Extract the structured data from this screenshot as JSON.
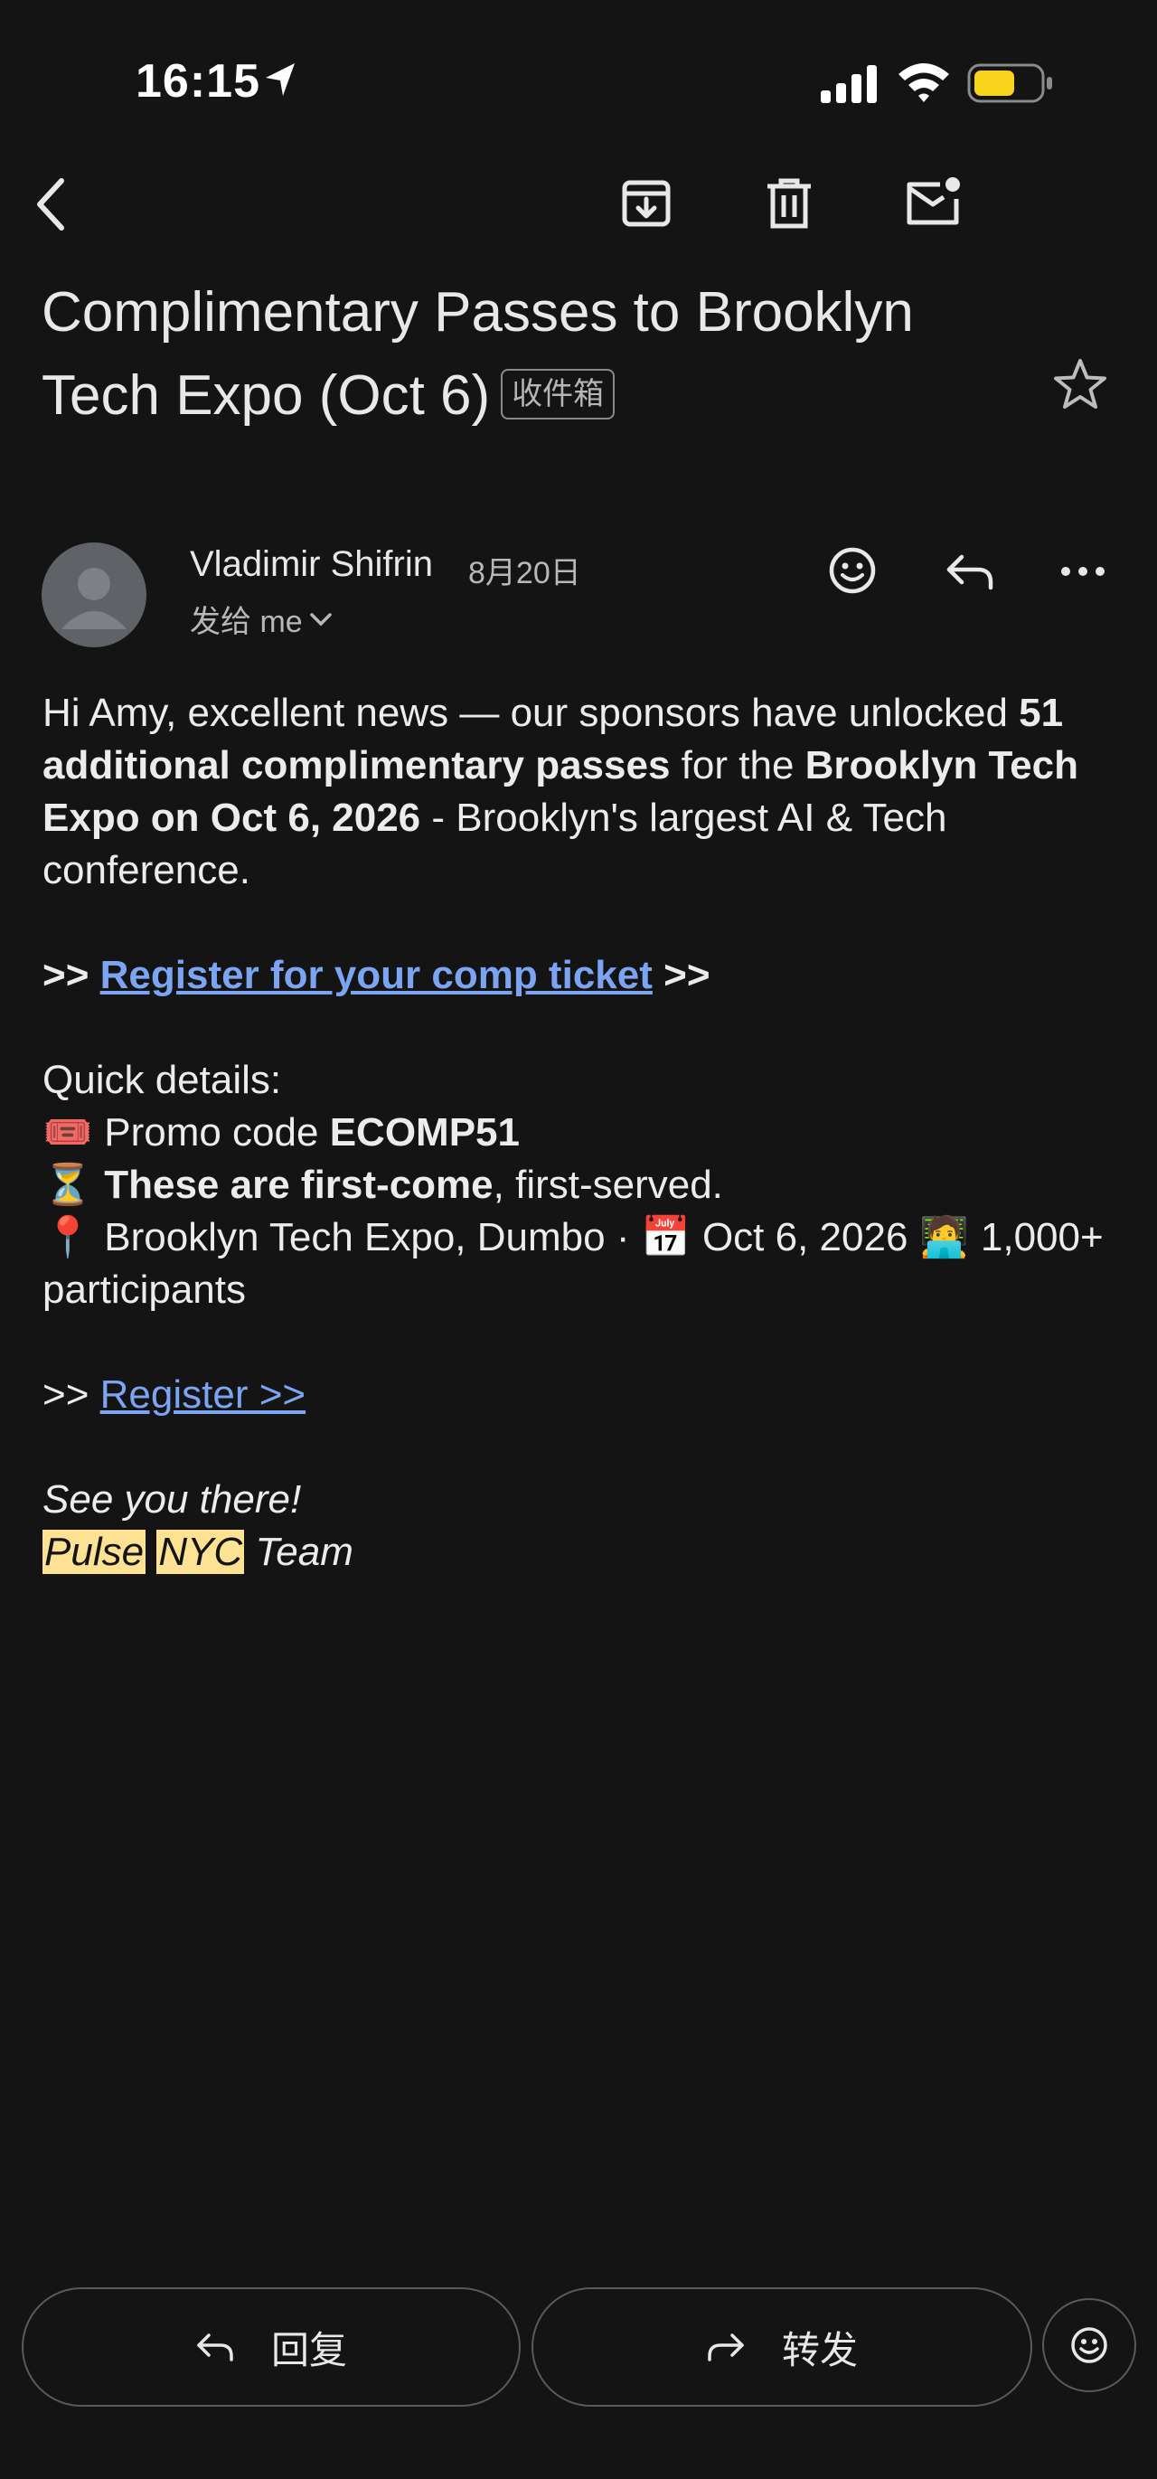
{
  "status_bar": {
    "time": "16:15",
    "battery_color": "#f8d21b"
  },
  "toolbar": {
    "back_icon": "back-arrow-icon",
    "archive_icon": "archive-icon",
    "delete_icon": "trash-icon",
    "mark_unread_icon": "mark-unread-icon"
  },
  "email": {
    "subject": "Complimentary Passes to Brooklyn Tech Expo (Oct 6)",
    "label": "收件箱",
    "sender": "Vladimir Shifrin",
    "date": "8月20日",
    "recipient": "发给 me",
    "body": {
      "greeting_pre": "Hi Amy, excellent news — our sponsors have unlocked ",
      "greeting_bold": "51 additional complimentary passes",
      "greeting_mid": " for the ",
      "greeting_bold2": "Brooklyn Tech Expo on Oct 6, 2026",
      "greeting_post": " - Brooklyn's largest AI & Tech conference.",
      "cta_prefix": ">>",
      "cta_link": "Register for your comp ticket",
      "cta_suffix": ">>",
      "details_heading": "Quick details:",
      "promo_label": "Promo code ",
      "promo_code": "ECOMP51",
      "first_come_bold": "These are first-come",
      "first_come_rest": ", first-served.",
      "location": "Brooklyn Tech Expo, Dumbo · ",
      "event_date": "Oct 6, 2026",
      "participants": "1,000+ participants",
      "register_prefix": ">>",
      "register_link": "Register >>",
      "signoff": "See you there!",
      "team_hl1": "Pulse",
      "team_hl2": "NYC",
      "team_rest": "Team"
    }
  },
  "bottom_bar": {
    "reply_label": "回复",
    "forward_label": "转发"
  },
  "colors": {
    "background": "#141414",
    "link": "#7ba4f2",
    "highlight": "#fde293"
  }
}
